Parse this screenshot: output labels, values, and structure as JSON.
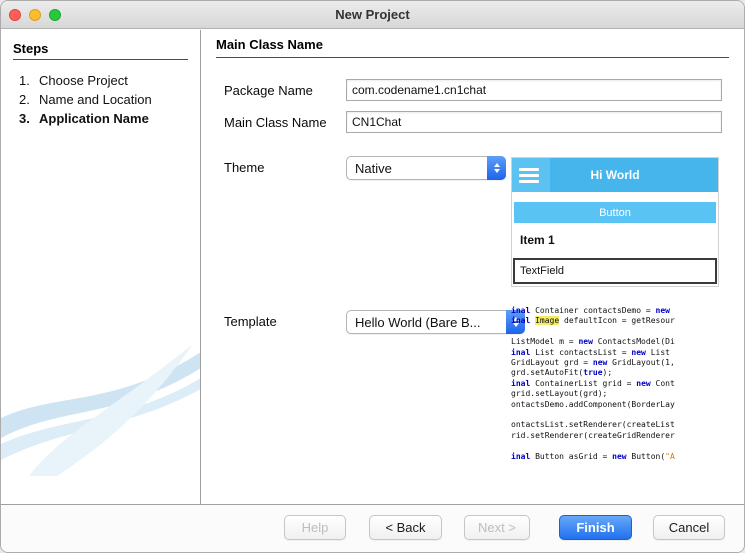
{
  "window": {
    "title": "New Project"
  },
  "steps_panel": {
    "title": "Steps",
    "items": [
      {
        "number": "1.",
        "label": "Choose Project",
        "current": false
      },
      {
        "number": "2.",
        "label": "Name and Location",
        "current": false
      },
      {
        "number": "3.",
        "label": "Application Name",
        "current": true
      }
    ]
  },
  "main": {
    "title": "Main Class Name",
    "package_name": {
      "label": "Package Name",
      "value": "com.codename1.cn1chat"
    },
    "main_class": {
      "label": "Main Class Name",
      "value": "CN1Chat"
    },
    "theme": {
      "label": "Theme",
      "value": "Native"
    },
    "template": {
      "label": "Template",
      "value": "Hello World (Bare B..."
    },
    "preview": {
      "header_title": "Hi World",
      "button_label": "Button",
      "item_label": "Item 1",
      "textfield_value": "TextField"
    },
    "code_preview": {
      "lines": [
        [
          [
            "k",
            "inal "
          ],
          [
            "p",
            "Container contactsDemo = "
          ],
          [
            "k",
            "new"
          ],
          [
            "p",
            " "
          ]
        ],
        [
          [
            "k",
            "inal "
          ],
          [
            "hl",
            "Image"
          ],
          [
            "p",
            " defaultIcon = getResour"
          ]
        ],
        [],
        [
          [
            "p",
            "ListModel m = "
          ],
          [
            "k",
            "new"
          ],
          [
            "p",
            " ContactsModel(Di"
          ]
        ],
        [
          [
            "k",
            "inal "
          ],
          [
            "p",
            "List contactsList = "
          ],
          [
            "k",
            "new"
          ],
          [
            "p",
            " List"
          ]
        ],
        [
          [
            "p",
            "GridLayout grd = "
          ],
          [
            "k",
            "new"
          ],
          [
            "p",
            " GridLayout(1, "
          ]
        ],
        [
          [
            "p",
            "grd.setAutoFit("
          ],
          [
            "k",
            "true"
          ],
          [
            "p",
            ");"
          ]
        ],
        [
          [
            "k",
            "inal "
          ],
          [
            "p",
            "ContainerList grid = "
          ],
          [
            "k",
            "new"
          ],
          [
            "p",
            " Cont"
          ]
        ],
        [
          [
            "p",
            "grid.setLayout(grd);"
          ]
        ],
        [
          [
            "p",
            "ontactsDemo.addComponent(BorderLay"
          ]
        ],
        [],
        [
          [
            "p",
            "ontactsList.setRenderer(createList"
          ]
        ],
        [
          [
            "p",
            "rid.setRenderer(createGridRenderer"
          ]
        ],
        [],
        [
          [
            "k",
            "inal "
          ],
          [
            "p",
            "Button asGrid = "
          ],
          [
            "k",
            "new"
          ],
          [
            "p",
            " Button("
          ],
          [
            "s",
            "\"A"
          ]
        ]
      ]
    }
  },
  "footer": {
    "help": "Help",
    "back": "< Back",
    "next": "Next >",
    "finish": "Finish",
    "cancel": "Cancel"
  },
  "colors": {
    "preview_header_blue": "#45b5ec",
    "preview_button_blue": "#59c3f3",
    "stepper_blue": "#1d63ea",
    "finish_blue": "#2270ee",
    "code_keyword": "#0000c8",
    "code_string": "#ce7b00",
    "code_highlight_bg": "#f3ec67"
  }
}
